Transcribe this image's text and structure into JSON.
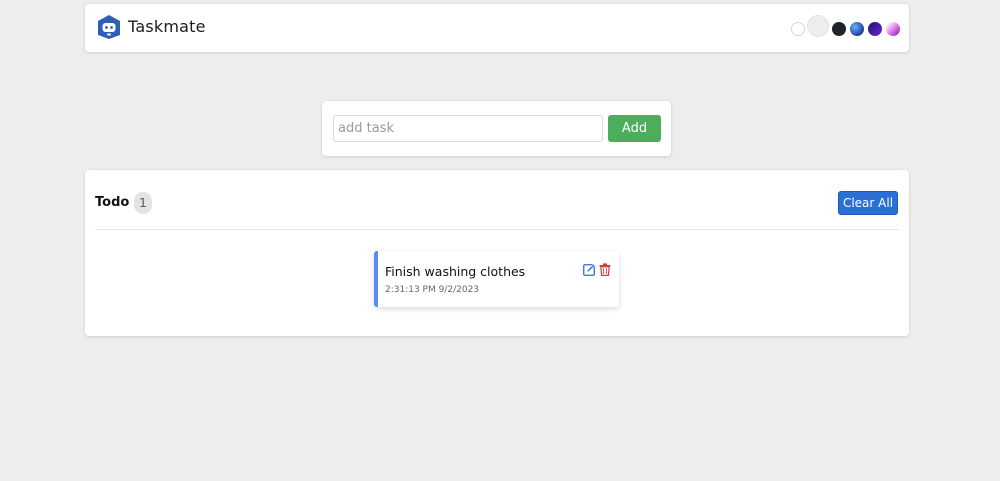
{
  "header": {
    "title": "Taskmate",
    "logo_icon": "robot-house-icon",
    "themes": [
      {
        "name": "white-theme",
        "color": "#ffffff"
      },
      {
        "name": "light-theme",
        "color": "#eeeeee"
      },
      {
        "name": "dark-theme",
        "color": "#1f232b"
      },
      {
        "name": "blue-theme",
        "color": "#1d3f98"
      },
      {
        "name": "purple-theme",
        "color": "#4b1fae"
      },
      {
        "name": "pink-theme",
        "color": "#e270e8"
      }
    ]
  },
  "add_task": {
    "placeholder": "add task",
    "value": "",
    "button_label": "Add",
    "button_color": "#4cae5d"
  },
  "todo": {
    "title": "Todo",
    "count": "1",
    "clear_label": "Clear All",
    "clear_color": "#2a6fd6",
    "tasks": [
      {
        "name": "Finish washing clothes",
        "time": "2:31:13 PM 9/2/2023",
        "accent": "#5b8def",
        "edit_icon": "edit-icon",
        "delete_icon": "trash-icon"
      }
    ]
  }
}
